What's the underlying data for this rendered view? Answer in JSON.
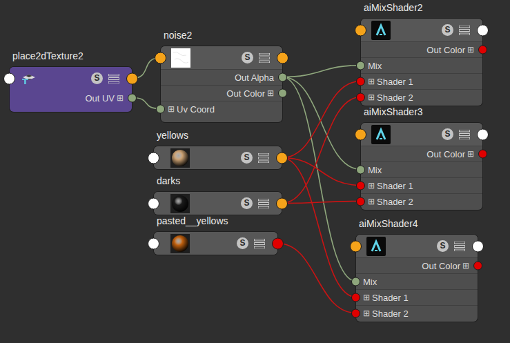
{
  "nodes": [
    {
      "name": "place2dTexture2",
      "kind": "utility",
      "badge": "S",
      "inPort": "#ffffff",
      "outPort": "#f5a31a",
      "swatch": "",
      "rows": [
        {
          "label": "Out UV",
          "side": "out",
          "toggle": "⊞",
          "port": "#8ea67c"
        }
      ]
    },
    {
      "name": "noise2",
      "kind": "texture",
      "badge": "S",
      "inPort": "#f5a31a",
      "outPort": "#f5a31a",
      "swatch": "#ffffff",
      "rows": [
        {
          "label": "Out Alpha",
          "side": "out",
          "toggle": "",
          "port": "#8ea67c"
        },
        {
          "label": "Out Color",
          "side": "out",
          "toggle": "⊞",
          "port": "#8ea67c"
        },
        {
          "label": "Uv Coord",
          "side": "in",
          "toggle": "⊞",
          "port": "#8ea67c"
        }
      ]
    },
    {
      "name": "yellows",
      "kind": "material",
      "badge": "S",
      "inPort": "#ffffff",
      "outPort": "#f5a31a",
      "swatch": "#c9a072",
      "rows": []
    },
    {
      "name": "darks",
      "kind": "material",
      "badge": "S",
      "inPort": "#ffffff",
      "outPort": "#f5a31a",
      "swatch": "#1a1a1a",
      "rows": []
    },
    {
      "name": "pasted__yellows",
      "kind": "material",
      "badge": "S",
      "inPort": "#ffffff",
      "outPort": "#e00000",
      "swatch": "#c0600e",
      "rows": []
    },
    {
      "name": "aiMixShader2",
      "kind": "shader",
      "badge": "S",
      "inPort": "#f5a31a",
      "outPort": "#ffffff",
      "swatch": "#5fd3e8",
      "rows": [
        {
          "label": "Out Color",
          "side": "out",
          "toggle": "⊞",
          "port": "#e00000"
        },
        {
          "label": "Mix",
          "side": "in",
          "toggle": "",
          "port": "#8ea67c"
        },
        {
          "label": "Shader 1",
          "side": "in",
          "toggle": "⊞",
          "port": "#e00000"
        },
        {
          "label": "Shader 2",
          "side": "in",
          "toggle": "⊞",
          "port": "#e00000"
        }
      ]
    },
    {
      "name": "aiMixShader3",
      "kind": "shader",
      "badge": "S",
      "inPort": "#f5a31a",
      "outPort": "#ffffff",
      "swatch": "#5fd3e8",
      "rows": [
        {
          "label": "Out Color",
          "side": "out",
          "toggle": "⊞",
          "port": "#e00000"
        },
        {
          "label": "Mix",
          "side": "in",
          "toggle": "",
          "port": "#8ea67c"
        },
        {
          "label": "Shader 1",
          "side": "in",
          "toggle": "⊞",
          "port": "#e00000"
        },
        {
          "label": "Shader 2",
          "side": "in",
          "toggle": "⊞",
          "port": "#e00000"
        }
      ]
    },
    {
      "name": "aiMixShader4",
      "kind": "shader",
      "badge": "S",
      "inPort": "#f5a31a",
      "outPort": "#ffffff",
      "swatch": "#5fd3e8",
      "rows": [
        {
          "label": "Out Color",
          "side": "out",
          "toggle": "⊞",
          "port": "#e00000"
        },
        {
          "label": "Mix",
          "side": "in",
          "toggle": "",
          "port": "#8ea67c"
        },
        {
          "label": "Shader 1",
          "side": "in",
          "toggle": "⊞",
          "port": "#e00000"
        },
        {
          "label": "Shader 2",
          "side": "in",
          "toggle": "⊞",
          "port": "#e00000"
        }
      ]
    }
  ],
  "connections": [
    {
      "from": "place2dTexture2",
      "fromPort": null,
      "to": "noise2",
      "toPort": null,
      "color": "#8ea67c"
    },
    {
      "from": "place2dTexture2",
      "fromPort": "Out UV",
      "to": "noise2",
      "toPort": "Uv Coord",
      "color": "#8ea67c"
    },
    {
      "from": "noise2",
      "fromPort": "Out Alpha",
      "to": "aiMixShader2",
      "toPort": "Mix",
      "color": "#8ea67c"
    },
    {
      "from": "noise2",
      "fromPort": "Out Alpha",
      "to": "aiMixShader3",
      "toPort": "Mix",
      "color": "#8ea67c"
    },
    {
      "from": "noise2",
      "fromPort": "Out Alpha",
      "to": "aiMixShader4",
      "toPort": "Mix",
      "color": "#8ea67c"
    },
    {
      "from": "yellows",
      "fromPort": null,
      "to": "aiMixShader2",
      "toPort": "Shader 1",
      "color": "#c81414"
    },
    {
      "from": "yellows",
      "fromPort": null,
      "to": "aiMixShader3",
      "toPort": "Shader 1",
      "color": "#c81414"
    },
    {
      "from": "yellows",
      "fromPort": null,
      "to": "aiMixShader4",
      "toPort": "Shader 1",
      "color": "#c81414"
    },
    {
      "from": "darks",
      "fromPort": null,
      "to": "aiMixShader2",
      "toPort": "Shader 2",
      "color": "#c81414"
    },
    {
      "from": "darks",
      "fromPort": null,
      "to": "aiMixShader3",
      "toPort": "Shader 2",
      "color": "#c81414"
    },
    {
      "from": "pasted__yellows",
      "fromPort": null,
      "to": "aiMixShader4",
      "toPort": "Shader 2",
      "color": "#c81414"
    }
  ]
}
